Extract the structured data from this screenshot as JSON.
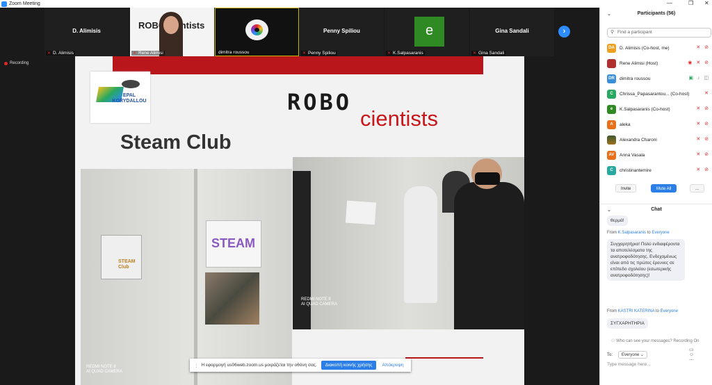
{
  "window": {
    "title": "Zoom Meeting"
  },
  "video_strip": {
    "tiles": [
      {
        "display_name": "D. Alimisis",
        "label": "D. Alimisis"
      },
      {
        "display_name": "",
        "label": "Rene Alimisi",
        "overlay_text": "ROBO cientists"
      },
      {
        "display_name": "",
        "label": "dimitra roussou"
      },
      {
        "display_name": "Penny Spiliou",
        "label": "Penny Spiliou"
      },
      {
        "display_name": "",
        "label": "K.Salpasaranis",
        "avatar_letter": "e"
      },
      {
        "display_name": "Gina Sandali",
        "label": "Gina Sandali"
      }
    ]
  },
  "recording": {
    "label": "Recording"
  },
  "slide": {
    "school_logo_text": "EPAL KORYDALLOU",
    "logo_robo": "ROBO",
    "logo_scientists": "cientists",
    "heading": "Steam Club",
    "photo_left_watermark": [
      "REDMI NOTE 8",
      "AI QUAD CAMERA"
    ],
    "photo_right_watermark": [
      "REDMI NOTE 8",
      "AI QUAD CAMERA"
    ],
    "door_sign_top": "STEAM",
    "door_sign_card": "STEAM Club"
  },
  "share_bar": {
    "message": "Η εφαρμογή us06web.zoom.us μοιράζεται την οθόνη σας.",
    "stop_button": "Διακοπή κοινής χρήσης",
    "hide_button": "Απόκρυψη"
  },
  "participants": {
    "header": "Participants (56)",
    "search_placeholder": "Find a participant",
    "list": [
      {
        "initials": "DA",
        "name": "D. Alimisis (Co-host, me)",
        "color": "#f0a020"
      },
      {
        "initials": "",
        "name": "Rene Alimisi (Host)",
        "color": "#b03030"
      },
      {
        "initials": "DR",
        "name": "dimitra roussou",
        "color": "#3a8fd8"
      },
      {
        "initials": "C",
        "name": "Chrissa_Papasarantou... (Co-host)",
        "color": "#28a860"
      },
      {
        "initials": "e",
        "name": "K.Salpasaranis (Co-host)",
        "color": "#2f8a23"
      },
      {
        "initials": "A",
        "name": "aleka",
        "color": "#e8701a"
      },
      {
        "initials": "",
        "name": "Alexandra Charoni",
        "color": "#806020"
      },
      {
        "initials": "AV",
        "name": "Anna Vasala",
        "color": "#e8701a"
      },
      {
        "initials": "C",
        "name": "christinantemire",
        "color": "#28a8a0"
      }
    ],
    "invite_button": "Invite",
    "mute_all_button": "Mute All",
    "more_button": "..."
  },
  "chat": {
    "header": "Chat",
    "messages": [
      {
        "from": "",
        "to": "",
        "text": "θερμά!"
      },
      {
        "from": "K.Salpasaranis",
        "to": "Everyone",
        "text": "Συγχαρητήρια! Πολύ ενδιαφέροντα τα αποτελέσματα της ανατροφοδότησης. Ενδεχομένως είναι από τις πρώτες έρευνες σε επίπεδο σχολείου (εσωτερικής ανατροφοδότησης)!"
      },
      {
        "from": "KASTRI KATERINA",
        "to": "Everyone",
        "text": "ΣΥΓΧΑΡΗΤΗΡΙΑ"
      }
    ],
    "from_label": "From",
    "to_label": "to",
    "who_can_see": "Who can see your messages? Recording On",
    "to_prefix": "To:",
    "recipient": "Everyone",
    "input_placeholder": "Type message here..."
  }
}
